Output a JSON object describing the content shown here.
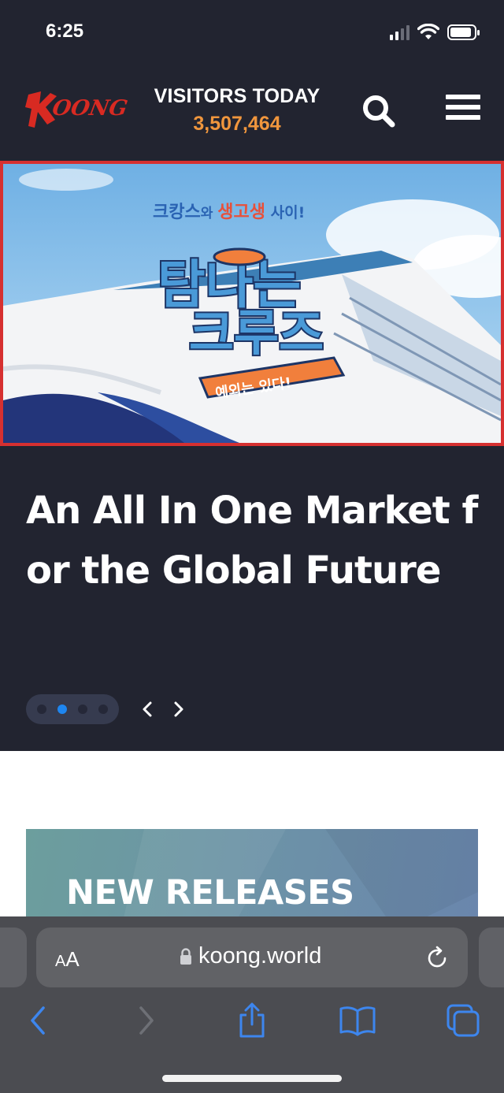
{
  "status_bar": {
    "time": "6:25"
  },
  "header": {
    "logo_text": "KOONG",
    "visitors_label": "VISITORS TODAY",
    "visitors_count": "3,507,464"
  },
  "banner": {
    "line1_a": "크캉스",
    "line1_b": "와 ",
    "line1_c": "생고생",
    "line1_d": " 사이!",
    "title_top": "탐나는",
    "title_bottom": "크루즈",
    "ribbon": "예외는 있다!"
  },
  "hero": {
    "headline": "An All In One Market for the Global Future",
    "slide_count": 4,
    "active_slide": 2
  },
  "releases": {
    "title": "NEW RELEASES"
  },
  "browser": {
    "aa_small": "A",
    "aa_big": "A",
    "url": "koong.world"
  },
  "colors": {
    "background_dark": "#222430",
    "accent_orange": "#f0963d",
    "accent_red": "#d63030",
    "active_dot": "#1e86f0",
    "safari_blue": "#3d86ee"
  }
}
